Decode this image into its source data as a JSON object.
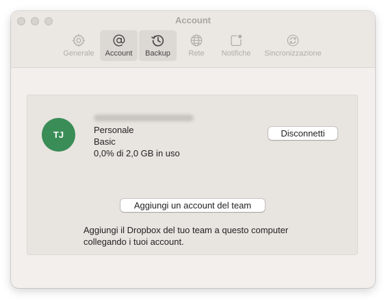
{
  "window": {
    "title": "Account"
  },
  "toolbar": {
    "items": [
      {
        "label": "Generale",
        "icon": "gear-icon",
        "enabled": false,
        "selected": false
      },
      {
        "label": "Account",
        "icon": "at-sign-icon",
        "enabled": true,
        "selected": true
      },
      {
        "label": "Backup",
        "icon": "history-clock-icon",
        "enabled": true,
        "selected": true
      },
      {
        "label": "Rete",
        "icon": "globe-icon",
        "enabled": false,
        "selected": false
      },
      {
        "label": "Notifiche",
        "icon": "notification-badge-icon",
        "enabled": false,
        "selected": false
      },
      {
        "label": "Sincronizzazione",
        "icon": "sync-icon",
        "enabled": false,
        "selected": false
      }
    ]
  },
  "account": {
    "initials": "TJ",
    "avatar_color": "#3a8d57",
    "plan_type": "Personale",
    "plan_name": "Basic",
    "usage": "0,0% di 2,0 GB in uso",
    "disconnect_label": "Disconnetti"
  },
  "team": {
    "button_label": "Aggiungi un account del team",
    "description": "Aggiungi il Dropbox del tuo team a questo computer collegando i tuoi account."
  }
}
